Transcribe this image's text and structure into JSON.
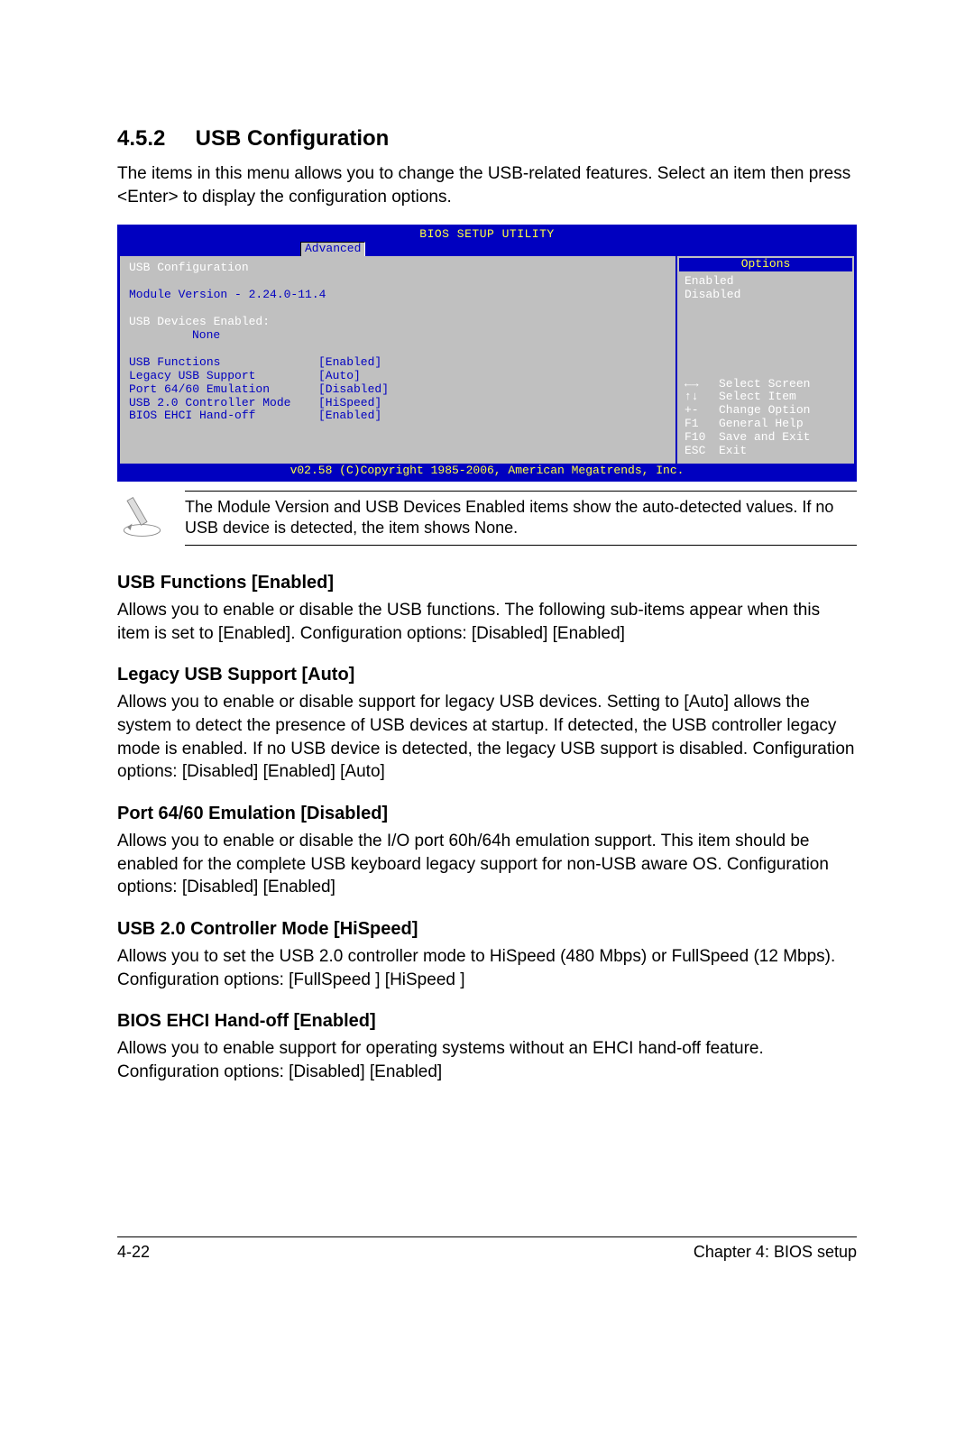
{
  "section": {
    "number": "4.5.2",
    "title": "USB Configuration"
  },
  "intro": "The items in this menu allows you to change the USB-related features. Select an item then press <Enter> to display the configuration options.",
  "bios": {
    "title": "BIOS SETUP UTILITY",
    "tab": "Advanced",
    "heading": "USB Configuration",
    "module_version": "Module Version - 2.24.0-11.4",
    "devices_label": "USB Devices Enabled:",
    "devices_value": "None",
    "items": [
      {
        "label": "USB Functions",
        "value": "[Enabled]"
      },
      {
        "label": "Legacy USB Support",
        "value": "[Auto]"
      },
      {
        "label": "Port 64/60 Emulation",
        "value": "[Disabled]"
      },
      {
        "label": "USB 2.0 Controller Mode",
        "value": "[HiSpeed]"
      },
      {
        "label": "BIOS EHCI Hand-off",
        "value": "[Enabled]"
      }
    ],
    "options_title": "Options",
    "options": [
      "Enabled",
      "Disabled"
    ],
    "help": [
      {
        "key": "←→",
        "text": "Select Screen"
      },
      {
        "key": "↑↓",
        "text": "Select Item"
      },
      {
        "key": "+-",
        "text": "Change Option"
      },
      {
        "key": "F1",
        "text": "General Help"
      },
      {
        "key": "F10",
        "text": "Save and Exit"
      },
      {
        "key": "ESC",
        "text": "Exit"
      }
    ],
    "copyright": "v02.58 (C)Copyright 1985-2006, American Megatrends, Inc."
  },
  "note": "The Module Version and USB Devices Enabled items show the auto-detected values. If no USB device is detected, the item shows None.",
  "options": [
    {
      "title": "USB Functions [Enabled]",
      "body": "Allows you to enable or disable the USB functions. The following sub-items appear when this item is set to [Enabled]. Configuration options: [Disabled] [Enabled]"
    },
    {
      "title": "Legacy USB Support [Auto]",
      "body": "Allows you to enable or disable support for legacy USB devices. Setting to [Auto] allows the system to detect the presence of USB devices at startup. If detected, the USB controller legacy mode is enabled. If no USB device is detected, the legacy USB support is disabled. Configuration options: [Disabled] [Enabled] [Auto]"
    },
    {
      "title": "Port 64/60 Emulation [Disabled]",
      "body": "Allows you to enable or disable the I/O port 60h/64h emulation support. This item should be enabled for the complete USB keyboard legacy support for non-USB aware OS. Configuration options: [Disabled] [Enabled]"
    },
    {
      "title": "USB 2.0 Controller Mode [HiSpeed]",
      "body": "Allows you to set the USB 2.0 controller mode to HiSpeed (480 Mbps) or FullSpeed (12 Mbps). Configuration options: [FullSpeed ] [HiSpeed ]"
    },
    {
      "title": "BIOS EHCI Hand-off [Enabled]",
      "body": "Allows you to enable support for operating systems without an EHCI hand-off feature. Configuration options: [Disabled] [Enabled]"
    }
  ],
  "footer": {
    "left": "4-22",
    "right": "Chapter 4: BIOS setup"
  }
}
